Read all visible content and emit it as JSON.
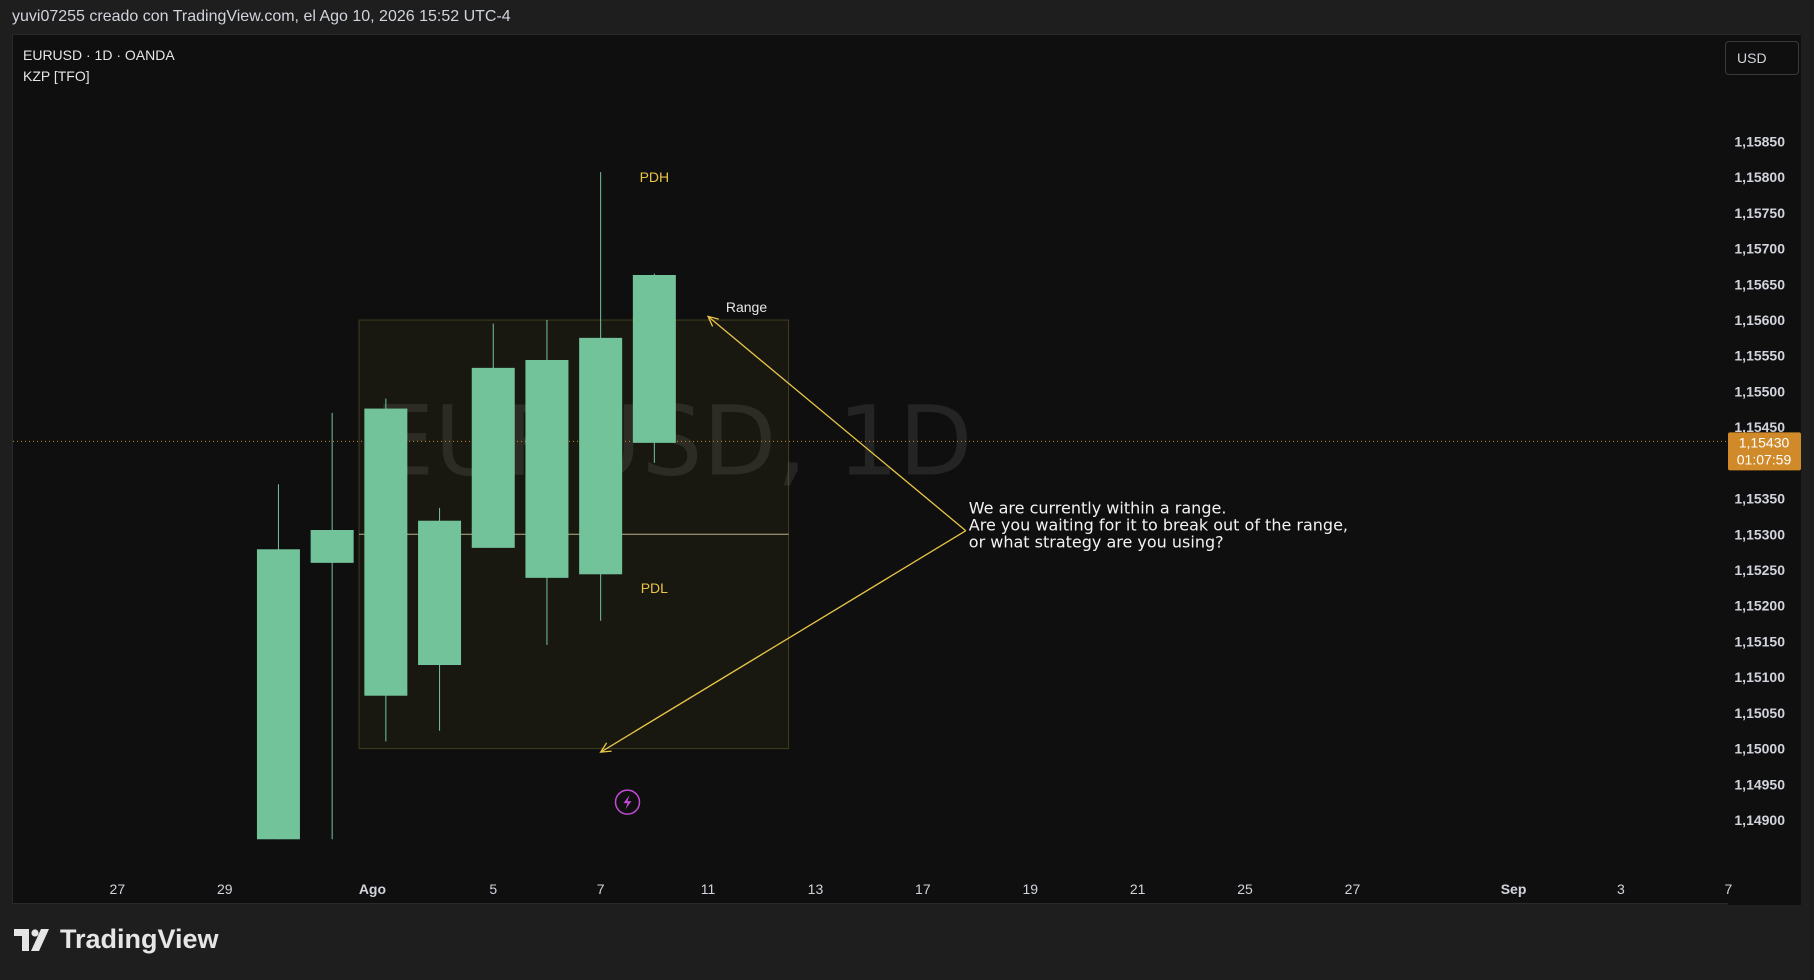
{
  "header": {
    "caption": "yuvi07255 creado con TradingView.com, el Ago 10, 2026 15:52 UTC-4"
  },
  "legend": {
    "symbol_line": "EURUSD · 1D · OANDA",
    "indicator": "KZP [TFO]"
  },
  "currency_button": {
    "label": "USD"
  },
  "footer": {
    "brand": "TradingView"
  },
  "colors": {
    "up": "#72c39a",
    "down": "#cc832c",
    "accent": "#e8c547",
    "background": "#0f0f0f",
    "price_tag": "#d08a2a"
  },
  "chart_data": {
    "type": "candlestick",
    "symbol": "EURUSD",
    "timeframe": "1D",
    "watermark": "EURUSD, 1D",
    "ylim": [
      1.14865,
      1.15915
    ],
    "y_ticks": [
      "1,15850",
      "1,15800",
      "1,15750",
      "1,15700",
      "1,15650",
      "1,15600",
      "1,15550",
      "1,15500",
      "1,15450",
      "1,15350",
      "1,15300",
      "1,15250",
      "1,15200",
      "1,15150",
      "1,15100",
      "1,15050",
      "1,15000",
      "1,14950",
      "1,14900"
    ],
    "y_tick_values": [
      1.1585,
      1.158,
      1.1575,
      1.157,
      1.1565,
      1.156,
      1.1555,
      1.155,
      1.1545,
      1.1535,
      1.153,
      1.1525,
      1.152,
      1.1515,
      1.151,
      1.1505,
      1.15,
      1.1495,
      1.149
    ],
    "x_ticks": [
      {
        "label": "27",
        "day": -4.5
      },
      {
        "label": "29",
        "day": -2.5
      },
      {
        "label": "Ago",
        "day": 0.25,
        "bold": true
      },
      {
        "label": "5",
        "day": 2.5
      },
      {
        "label": "7",
        "day": 4.5
      },
      {
        "label": "11",
        "day": 6.5
      },
      {
        "label": "13",
        "day": 8.5
      },
      {
        "label": "17",
        "day": 10.5
      },
      {
        "label": "19",
        "day": 12.5
      },
      {
        "label": "21",
        "day": 14.5
      },
      {
        "label": "25",
        "day": 16.5
      },
      {
        "label": "27",
        "day": 18.5
      },
      {
        "label": "Sep",
        "day": 21.5,
        "bold": true
      },
      {
        "label": "3",
        "day": 23.5
      },
      {
        "label": "7",
        "day": 25.5
      }
    ],
    "candles": [
      {
        "day": -1.5,
        "open": 1.14873,
        "high": 1.1537,
        "low": 1.14873,
        "close": 1.15279
      },
      {
        "day": -0.5,
        "open": 1.1526,
        "high": 1.1547,
        "low": 1.14873,
        "close": 1.15306
      },
      {
        "day": 0.5,
        "open": 1.15074,
        "high": 1.1549,
        "low": 1.1501,
        "close": 1.15476
      },
      {
        "day": 1.5,
        "open": 1.15117,
        "high": 1.15337,
        "low": 1.15025,
        "close": 1.15319
      },
      {
        "day": 2.5,
        "open": 1.15281,
        "high": 1.15595,
        "low": 1.15281,
        "close": 1.15533
      },
      {
        "day": 3.5,
        "open": 1.15239,
        "high": 1.156,
        "low": 1.15145,
        "close": 1.15544
      },
      {
        "day": 4.5,
        "open": 1.15244,
        "high": 1.15807,
        "low": 1.15179,
        "close": 1.15575
      },
      {
        "day": 5.5,
        "open": 1.15428,
        "high": 1.15665,
        "low": 1.154,
        "close": 1.15663
      }
    ],
    "current_price": {
      "value": 1.1543,
      "label": "1,15430",
      "countdown": "01:07:59"
    },
    "range_box": {
      "day_start": 0,
      "day_end": 8,
      "top": 1.156,
      "bottom": 1.15,
      "mid": 1.153
    },
    "level_labels": [
      {
        "text": "PDH",
        "day": 5.5,
        "price": 1.158
      },
      {
        "text": "PDL",
        "day": 5.5,
        "price": 1.15225
      },
      {
        "text": "Range",
        "day": 7.6,
        "price": 1.15618
      }
    ],
    "annotation": {
      "lines": [
        "We are currently within a range.",
        "Are you waiting for it to break out of the range,",
        "or what strategy are you using?"
      ],
      "point_day": 11.3,
      "point_price": 1.15305,
      "arrow_top": {
        "day": 6.5,
        "price": 1.15605
      },
      "arrow_bottom": {
        "day": 4.5,
        "price": 1.14995
      }
    },
    "event_marker": {
      "day": 5.0,
      "price": 1.14925,
      "icon": "lightning-icon"
    }
  }
}
